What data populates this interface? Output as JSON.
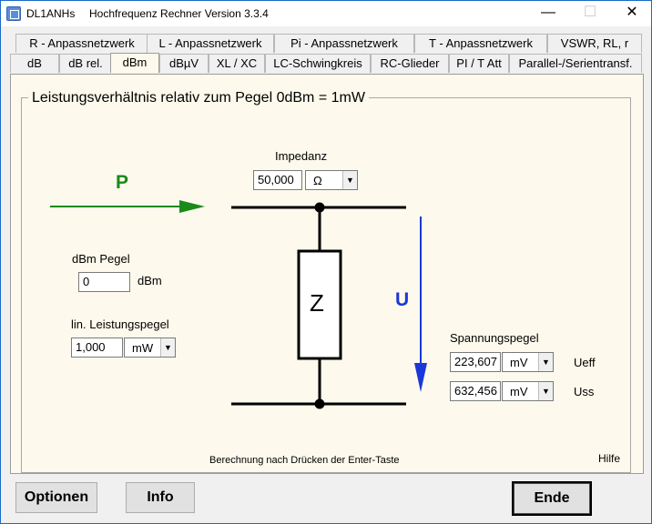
{
  "window": {
    "short_title": "DL1ANHs",
    "title": "Hochfrequenz Rechner Version 3.3.4",
    "minimize": "—",
    "maximize": "☐",
    "close": "✕"
  },
  "tabs_row1": [
    "R - Anpassnetzwerk",
    "L - Anpassnetzwerk",
    "Pi - Anpassnetzwerk",
    "T - Anpassnetzwerk",
    "VSWR, RL, r"
  ],
  "tabs_row2": [
    "dB",
    "dB rel.",
    "dBm",
    "dBµV",
    "XL / XC",
    "LC-Schwingkreis",
    "RC-Glieder",
    "PI / T Att",
    "Parallel-/Serientransf."
  ],
  "active_tab": "dBm",
  "group_title": "Leistungsverhältnis relativ zum Pegel   0dBm = 1mW",
  "impedance": {
    "label": "Impedanz",
    "value": "50,000",
    "unit": "Ω"
  },
  "diagram": {
    "p_label": "P",
    "u_label": "U",
    "z_label": "Z"
  },
  "dbm_pegel": {
    "label": "dBm Pegel",
    "value": "0",
    "unit": "dBm"
  },
  "lin_pegel": {
    "label": "lin. Leistungspegel",
    "value": "1,000",
    "unit": "mW"
  },
  "spannung": {
    "label": "Spannungspegel",
    "ueff_value": "223,607",
    "ueff_unit": "mV",
    "ueff_label": "Ueff",
    "uss_value": "632,456",
    "uss_unit": "mV",
    "uss_label": "Uss"
  },
  "hint": "Berechnung  nach Drücken der Enter-Taste",
  "help": "Hilfe",
  "buttons": {
    "options": "Optionen",
    "info": "Info",
    "end": "Ende"
  },
  "colors": {
    "power_arrow": "#1a8a1a",
    "voltage_arrow": "#1a38d8",
    "pane_bg": "#fdf9ec"
  }
}
